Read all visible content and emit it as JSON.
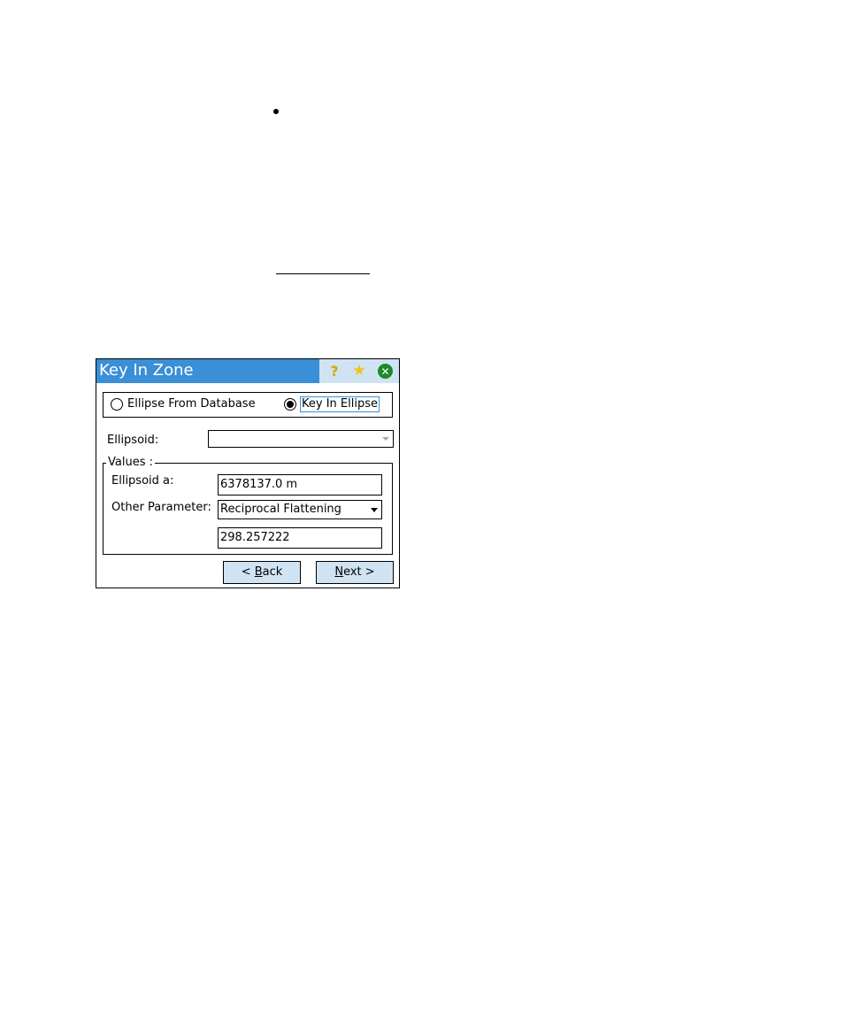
{
  "window": {
    "title": "Key In Zone",
    "icons": [
      "help-icon",
      "favorites-star-icon",
      "close-icon"
    ]
  },
  "source": {
    "option_database": "Ellipse From Database",
    "option_keyin": "Key In Ellipse",
    "selected": "Key In Ellipse"
  },
  "ellipsoid": {
    "label": "Ellipsoid:",
    "value": ""
  },
  "values": {
    "group_label": "Values :",
    "ellipsoid_a_label": "Ellipsoid a:",
    "ellipsoid_a_value": "6378137.0 m",
    "other_param_label": "Other Parameter:",
    "other_param_selected": "Reciprocal Flattening",
    "other_param_value": "298.257222"
  },
  "buttons": {
    "back_prefix": "< ",
    "back_accel": "B",
    "back_rest": "ack",
    "next_accel": "N",
    "next_rest": "ext >"
  }
}
